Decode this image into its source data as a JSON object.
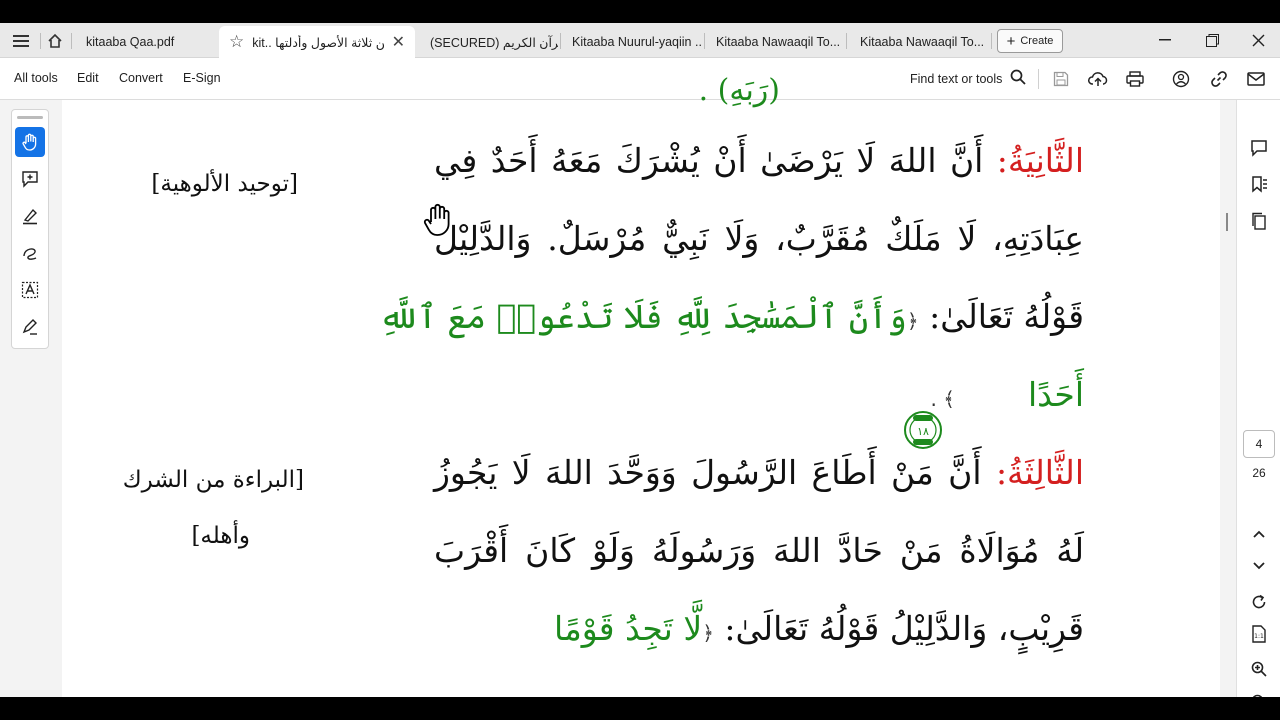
{
  "tabs": [
    {
      "label": "kitaaba Qaa.pdf",
      "active": false
    },
    {
      "label": "kit.. متن ثلاثة الأصول وأدلتها",
      "active": true
    },
    {
      "label": "(SECURED) القرآن الكريم",
      "active": false
    },
    {
      "label": "Kitaaba Nuurul-yaqiin ...",
      "active": false
    },
    {
      "label": "Kitaaba Nawaaqil To...",
      "active": false
    },
    {
      "label": "Kitaaba Nawaaqil To...",
      "active": false
    }
  ],
  "create_label": "Create",
  "menus": [
    "All tools",
    "Edit",
    "Convert",
    "E-Sign"
  ],
  "find_label": "Find text or tools",
  "page": {
    "current": "4",
    "total": "26"
  },
  "document": {
    "top_fragment": "(رَبَهِ) .",
    "section2": {
      "head": "الثَّانِيَةُ:",
      "line1": "أَنَّ اللهَ لَا يَرْضَىٰ أَنْ يُشْرَكَ مَعَهُ أَحَدٌ فِي",
      "line2": "عِبَادَتِهِ، لَا مَلَكٌ مُقَرَّبٌ، وَلَا نَبِيٌّ مُرْسَلٌ. وَالدَّلِيْلُ",
      "line3_black": "قَوْلُهُ تَعَالَىٰ:",
      "line3_open": "﴿",
      "line3_green": "وَأَنَّ ٱلْمَسَٰجِدَ لِلَّهِ فَلَا تَدْعُوا۟ مَعَ ٱللَّهِ",
      "line4_green": "أَحَدًا",
      "verse_number": "١٨",
      "line4_close": "﴾ .",
      "side_note": "[توحيد الألوهية]"
    },
    "section3": {
      "head": "الثَّالِثَةُ:",
      "line1": "أَنَّ مَنْ أَطَاعَ الرَّسُولَ وَوَحَّدَ اللهَ لَا يَجُوزُ",
      "line2": "لَهُ مُوَالَاةُ مَنْ حَادَّ اللهَ وَرَسُولَهُ وَلَوْ كَانَ أَقْرَبَ",
      "line3_black": "قَرِيْبٍ، وَالدَّلِيْلُ قَوْلُهُ تَعَالَىٰ:",
      "line3_open": "﴿",
      "line3_green": "لَّا تَجِدُ قَوْمًا",
      "side_note_1": "[البراءة من الشرك",
      "side_note_2": "وأهله]"
    }
  }
}
